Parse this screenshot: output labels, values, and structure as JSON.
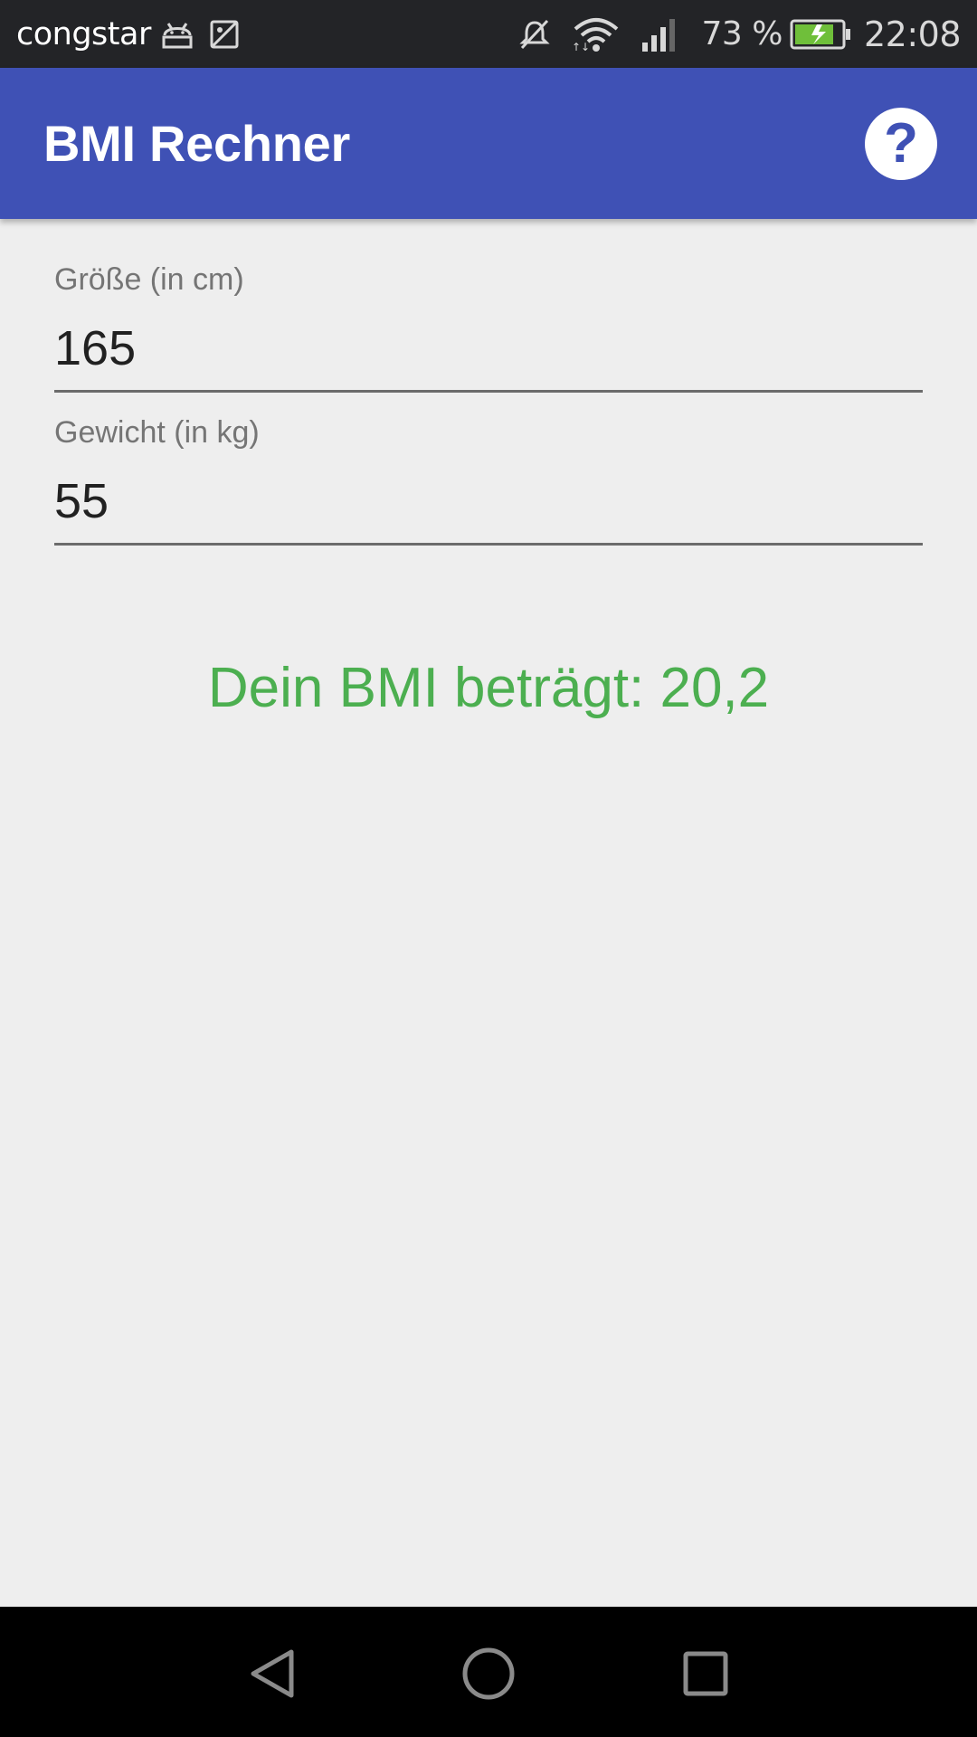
{
  "status_bar": {
    "carrier": "congstar",
    "battery_percent": "73 %",
    "time": "22:08",
    "icons": [
      "android-debug-icon",
      "image-icon",
      "mute-icon",
      "wifi-icon",
      "signal-icon",
      "battery-charging-icon"
    ]
  },
  "app_bar": {
    "title": "BMI Rechner",
    "help_icon": "help-icon",
    "color": "#3f51b5"
  },
  "form": {
    "height": {
      "label": "Größe (in cm)",
      "value": "165"
    },
    "weight": {
      "label": "Gewicht (in kg)",
      "value": "55"
    }
  },
  "result": {
    "text": "Dein BMI beträgt: 20,2",
    "color": "#4caf50"
  },
  "nav_bar": {
    "buttons": [
      "back-icon",
      "home-icon",
      "recents-icon"
    ]
  }
}
